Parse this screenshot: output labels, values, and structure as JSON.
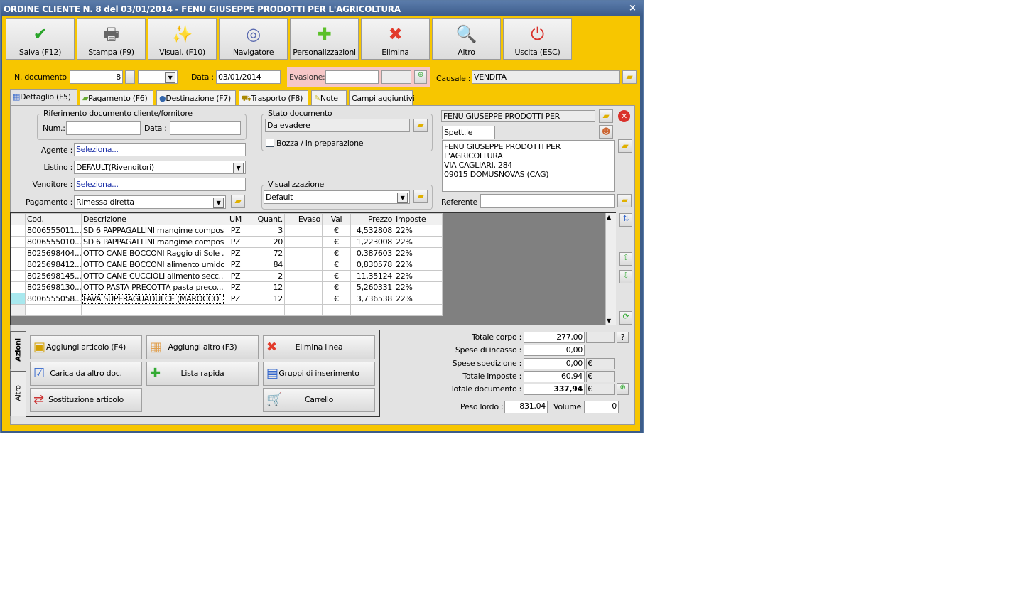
{
  "window": {
    "title": "ORDINE CLIENTE N. 8 del 03/01/2014 - FENU GIUSEPPE PRODOTTI PER L'AGRICOLTURA",
    "close": "×"
  },
  "toolbar": [
    {
      "label": "Salva (F12)",
      "icon": "check-icon",
      "glyph": "✔",
      "color": "#2aa52a"
    },
    {
      "label": "Stampa (F9)",
      "icon": "printer-icon",
      "glyph": "🖶",
      "color": "#666"
    },
    {
      "label": "Visual. (F10)",
      "icon": "magic-wand-icon",
      "glyph": "✨",
      "color": "#e0a000"
    },
    {
      "label": "Navigatore",
      "icon": "compass-icon",
      "glyph": "◎",
      "color": "#5a6ab0"
    },
    {
      "label": "Personalizzazioni",
      "icon": "puzzle-icon",
      "glyph": "✚",
      "color": "#5cc02a"
    },
    {
      "label": "Elimina",
      "icon": "delete-x-icon",
      "glyph": "✖",
      "color": "#e23b2b"
    },
    {
      "label": "Altro",
      "icon": "magnifier-icon",
      "glyph": "🔍",
      "color": "#3b6fd0"
    },
    {
      "label": "Uscita (ESC)",
      "icon": "power-icon",
      "glyph": "⏻",
      "color": "#d9302a"
    }
  ],
  "header": {
    "ndoc_label": "N. documento :",
    "ndoc": "8",
    "data_label": "Data :",
    "data": "03/01/2014",
    "evasione_label": "Evasione:",
    "causale_label": "Causale :",
    "causale": "VENDITA"
  },
  "tabs": [
    "Dettaglio (F5)",
    "Pagamento (F6)",
    "Destinazione (F7)",
    "Trasporto (F8)",
    "Note",
    "Campi aggiuntivi"
  ],
  "form": {
    "rif_title": "Riferimento documento cliente/fornitore",
    "num_label": "Num.:",
    "data_label": "Data :",
    "agente_label": "Agente :",
    "agente": "Seleziona...",
    "listino_label": "Listino :",
    "listino": "DEFAULT(Rivenditori)",
    "venditore_label": "Venditore :",
    "venditore": "Seleziona...",
    "pagamento_label": "Pagamento :",
    "pagamento": "Rimessa diretta",
    "stato_title": "Stato documento",
    "stato": "Da evadere",
    "bozza": "Bozza / in preparazione",
    "vis_title": "Visualizzazione",
    "vis": "Default"
  },
  "customer": {
    "name": "FENU GIUSEPPE PRODOTTI PER",
    "title": "Spett.le",
    "address": [
      "FENU GIUSEPPE PRODOTTI PER L'AGRICOLTURA",
      "VIA CAGLIARI, 284",
      "09015 DOMUSNOVAS (CAG)"
    ],
    "referente_label": "Referente"
  },
  "grid": {
    "columns": [
      "Cod.",
      "Descrizione",
      "UM",
      "Quant.",
      "Evaso",
      "Val",
      "Prezzo",
      "Imposte"
    ],
    "rows": [
      [
        "8006555011...",
        "SD 6 PAPPAGALLINI mangime compos...",
        "PZ",
        "3",
        "",
        "€",
        "4,532808",
        "22%"
      ],
      [
        "8006555010...",
        "SD 6 PAPPAGALLINI mangime compos...",
        "PZ",
        "20",
        "",
        "€",
        "1,223008",
        "22%"
      ],
      [
        "8025698404...",
        "OTTO CANE BOCCONI Raggio di Sole ...",
        "PZ",
        "72",
        "",
        "€",
        "0,387603",
        "22%"
      ],
      [
        "8025698412...",
        "OTTO CANE BOCCONI alimento umido...",
        "PZ",
        "84",
        "",
        "€",
        "0,830578",
        "22%"
      ],
      [
        "8025698145...",
        "OTTO CANE CUCCIOLI alimento secc...",
        "PZ",
        "2",
        "",
        "€",
        "11,35124",
        "22%"
      ],
      [
        "8025698130...",
        "OTTO PASTA PRECOTTA  pasta preco...",
        "PZ",
        "12",
        "",
        "€",
        "5,260331",
        "22%"
      ],
      [
        "8006555058...",
        "FAVA SUPERAGUADULCE (MAROCCO...",
        "PZ",
        "12",
        "",
        "€",
        "3,736538",
        "22%"
      ]
    ]
  },
  "actions": {
    "tab_azioni": "Azioni",
    "tab_altro": "Altro",
    "buttons": [
      "Aggiungi articolo (F4)",
      "Aggiungi altro (F3)",
      "Elimina linea",
      "Carica da altro doc.",
      "Lista rapida",
      "Gruppi di inserimento",
      "Sostituzione articolo",
      "Carrello"
    ]
  },
  "totals": {
    "corpo_label": "Totale corpo :",
    "corpo": "277,00",
    "help": "?",
    "incasso_label": "Spese di incasso :",
    "incasso": "0,00",
    "spedizione_label": "Spese spedizione :",
    "spedizione": "0,00",
    "imposte_label": "Totale imposte :",
    "imposte": "60,94",
    "documento_label": "Totale documento :",
    "documento": "337,94",
    "currency": "€",
    "peso_label": "Peso lordo :",
    "peso": "831,04",
    "volume_label": "Volume :",
    "volume": "0"
  }
}
